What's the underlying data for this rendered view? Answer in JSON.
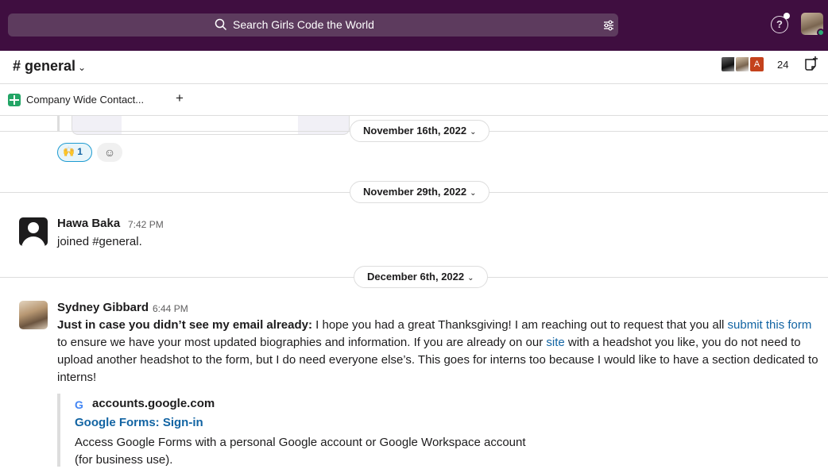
{
  "search": {
    "placeholder": "Search Girls Code the World"
  },
  "channel": {
    "name": "# general",
    "chevron": "⌄",
    "member_count": "24",
    "member_initial": "A"
  },
  "bookmarks": [
    {
      "label": "Company Wide Contact..."
    }
  ],
  "bookmark_add": "+",
  "reaction": {
    "emoji": "🙌",
    "count": "1"
  },
  "dates": [
    "November 16th, 2022",
    "November 29th, 2022",
    "December 6th, 2022"
  ],
  "date_chevron": "⌄",
  "messages": [
    {
      "author": "Hawa Baka",
      "time": "7:42 PM",
      "text": "joined #general."
    },
    {
      "author": "Sydney Gibbard",
      "time": "6:44 PM",
      "bold_lead": "Just in case you didn’t see my email already:",
      "text_1": " I hope you had a great Thanksgiving! I am reaching out to request that you all ",
      "link_1": "submit this form",
      "text_2": " to ensure we have your most updated biographies and information. If you are already on our ",
      "link_2": "site",
      "text_3": " with a headshot you like, you do not need to upload another headshot to the form, but I do need everyone else’s. This goes for interns too because I would like to have a section dedicated to interns!"
    }
  ],
  "unfurl": {
    "icon": "G",
    "site": "accounts.google.com",
    "title": "Google Forms: Sign-in",
    "description": "Access Google Forms with a personal Google account or Google Workspace account",
    "description_2": "(for business use)."
  },
  "colors": {
    "sidebar": "#3f0e40",
    "link": "#1264a3",
    "online": "#2bac76"
  }
}
